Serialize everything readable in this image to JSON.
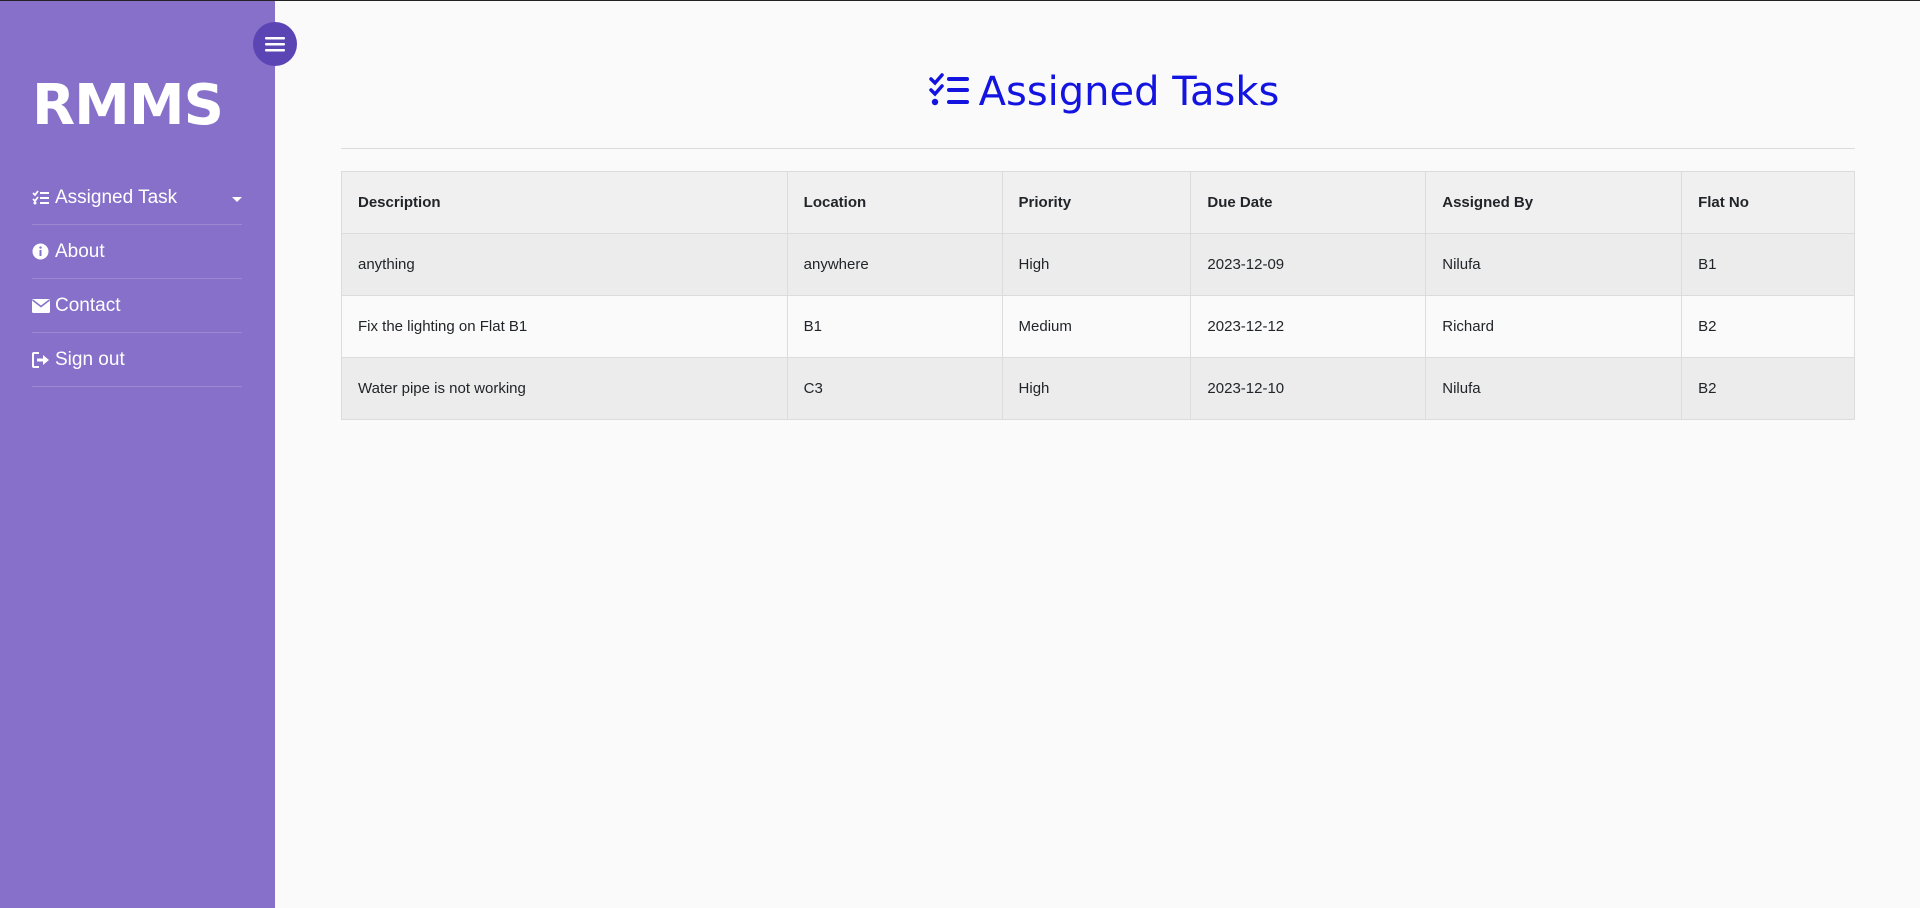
{
  "app": {
    "brand": "RMMS"
  },
  "sidebar": {
    "items": [
      {
        "label": "Assigned Task",
        "icon": "list-check-icon",
        "has_caret": true
      },
      {
        "label": "About",
        "icon": "info-circle-icon"
      },
      {
        "label": "Contact",
        "icon": "envelope-icon"
      },
      {
        "label": "Sign out",
        "icon": "sign-out-icon"
      }
    ]
  },
  "main": {
    "title": "Assigned Tasks",
    "title_icon": "list-check-icon",
    "title_color": "#1414e0",
    "table": {
      "headers": [
        "Description",
        "Location",
        "Priority",
        "Due Date",
        "Assigned By",
        "Flat No"
      ],
      "rows": [
        [
          "anything",
          "anywhere",
          "High",
          "2023-12-09",
          "Nilufa",
          "B1"
        ],
        [
          "Fix the lighting on Flat B1",
          "B1",
          "Medium",
          "2023-12-12",
          "Richard",
          "B2"
        ],
        [
          "Water pipe is not working",
          "C3",
          "High",
          "2023-12-10",
          "Nilufa",
          "B2"
        ]
      ]
    }
  },
  "colors": {
    "sidebar_bg": "#8670c9",
    "toggle_bg": "#5b44b4",
    "accent": "#1414e0"
  }
}
